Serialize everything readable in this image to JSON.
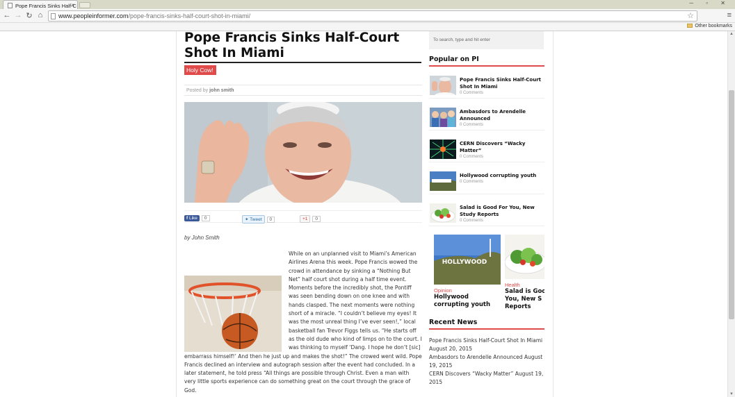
{
  "browser": {
    "tab_title": "Pope Francis Sinks Half-C",
    "tab_close": "×",
    "url_domain": "www.peopleinformer.com",
    "url_path": "/pope-francis-sinks-half-court-shot-in-miami/",
    "other_bookmarks": "Other bookmarks",
    "window_buttons": "─ ▫ ✕"
  },
  "article": {
    "headline": "Pope Francis Sinks Half-Court Shot In Miami",
    "category": "Holy Cow!",
    "posted_by_prefix": "Posted by",
    "author": "john smith",
    "social": {
      "fb_label": "Like",
      "fb_count": "0",
      "tw_label": "Tweet",
      "tw_count": "0",
      "gp_label": "+1",
      "gp_count": "0"
    },
    "by_author": "by John Smith",
    "para1": "While on an unplanned visit to Miami’s American Airlines Arena this week. Pope Francis wowed the crowd in attendance by sinking a “Nothing But Net” half court shot during a half time event. Moments before the incredibly shot, the Pontiff was seen bending down on one knee and with hands clasped. The next moments were nothing short of a miracle. “I couldn’t believe my eyes! It was the most unreal thing I’ve ever seen!,” local basketball fan Trevor Figgs tells us. “He starts off as the old dude  who kind of limps on to the court. I was thinking to myself ‘Dang. I hope he don’t [sic] embarrass himself!’ And then he just up and makes the shot!” The crowed went wild. Pope Francis declined an interview and autograph session after the event had concluded. In a later statement,  he told press “All things are possible through Christ. Even a man with very little sports experience can do something great on the court through the grace of God."
  },
  "sidebar": {
    "search_placeholder": "To search, type and hit enter",
    "popular_title": "Popular on PI",
    "popular": [
      {
        "title": "Pope Francis Sinks Half-Court Shot In Miami",
        "meta": "0 Comments"
      },
      {
        "title": "Ambasdors to Arendelle Announced",
        "meta": "0 Comments"
      },
      {
        "title": "CERN Discovers “Wacky Matter”",
        "meta": "0 Comments"
      },
      {
        "title": "Hollywood corrupting youth",
        "meta": "0 Comments"
      },
      {
        "title": "Salad is Good For You, New Study Reports",
        "meta": "0 Comments"
      }
    ],
    "carousel": [
      {
        "category": "Opinion",
        "title": "Hollywood corrupting youth",
        "sign": "HOLLYWOOD"
      },
      {
        "category": "Health",
        "title": "Salad is Goo You, New S Reports"
      }
    ],
    "recent_title": "Recent News",
    "recent": [
      {
        "title": "Pope Francis Sinks Half-Court Shot In Miami",
        "date": "August 20, 2015"
      },
      {
        "title": "Ambasdors to Arendelle Announced",
        "date": "August 19, 2015"
      },
      {
        "title": "CERN Discovers “Wacky Matter”",
        "date": "August 19, 2015"
      }
    ]
  }
}
